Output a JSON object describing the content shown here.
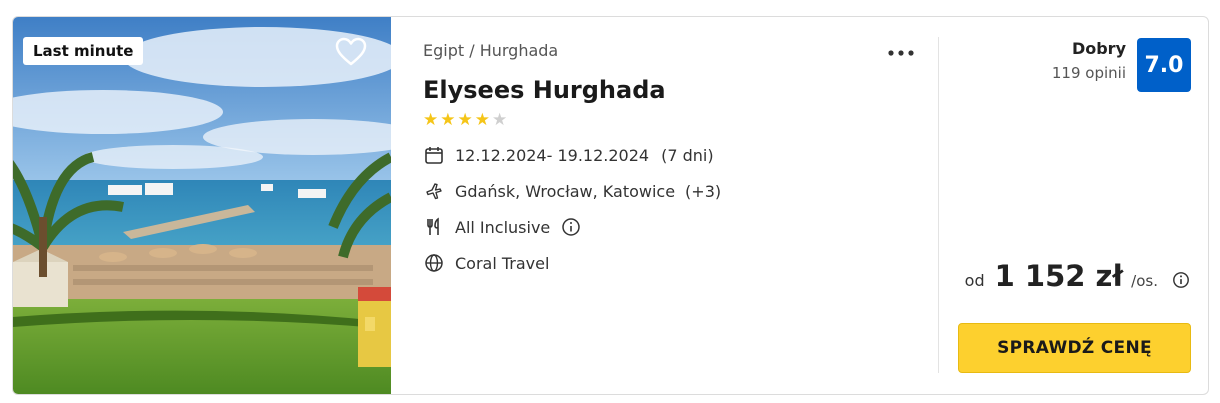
{
  "offer": {
    "badge": "Last minute",
    "location": "Egipt / Hurghada",
    "hotel_name": "Elysees Hurghada",
    "stars_filled": 4,
    "stars_total": 5,
    "dates": "12.12.2024- 19.12.2024",
    "duration": "(7 dni)",
    "departures": "Gdańsk, Wrocław, Katowice",
    "departures_more": "(+3)",
    "board": "All Inclusive",
    "operator": "Coral Travel"
  },
  "rating": {
    "label": "Dobry",
    "reviews": "119 opinii",
    "score": "7.0"
  },
  "price": {
    "from": "od",
    "amount": "1 152 zł",
    "per": "/os."
  },
  "cta": {
    "label": "SPRAWDŹ CENĘ"
  },
  "colors": {
    "star_filled": "#f5c518",
    "star_empty": "#cfcfcf",
    "rating_box": "#0060c9",
    "cta": "#fdd02e"
  },
  "icons": {
    "favorite": "heart-icon",
    "more": "more-dots-icon",
    "dates": "calendar-icon",
    "departures": "plane-icon",
    "board": "cutlery-icon",
    "board_info": "info-icon",
    "operator": "globe-icon",
    "price_info": "info-icon"
  }
}
